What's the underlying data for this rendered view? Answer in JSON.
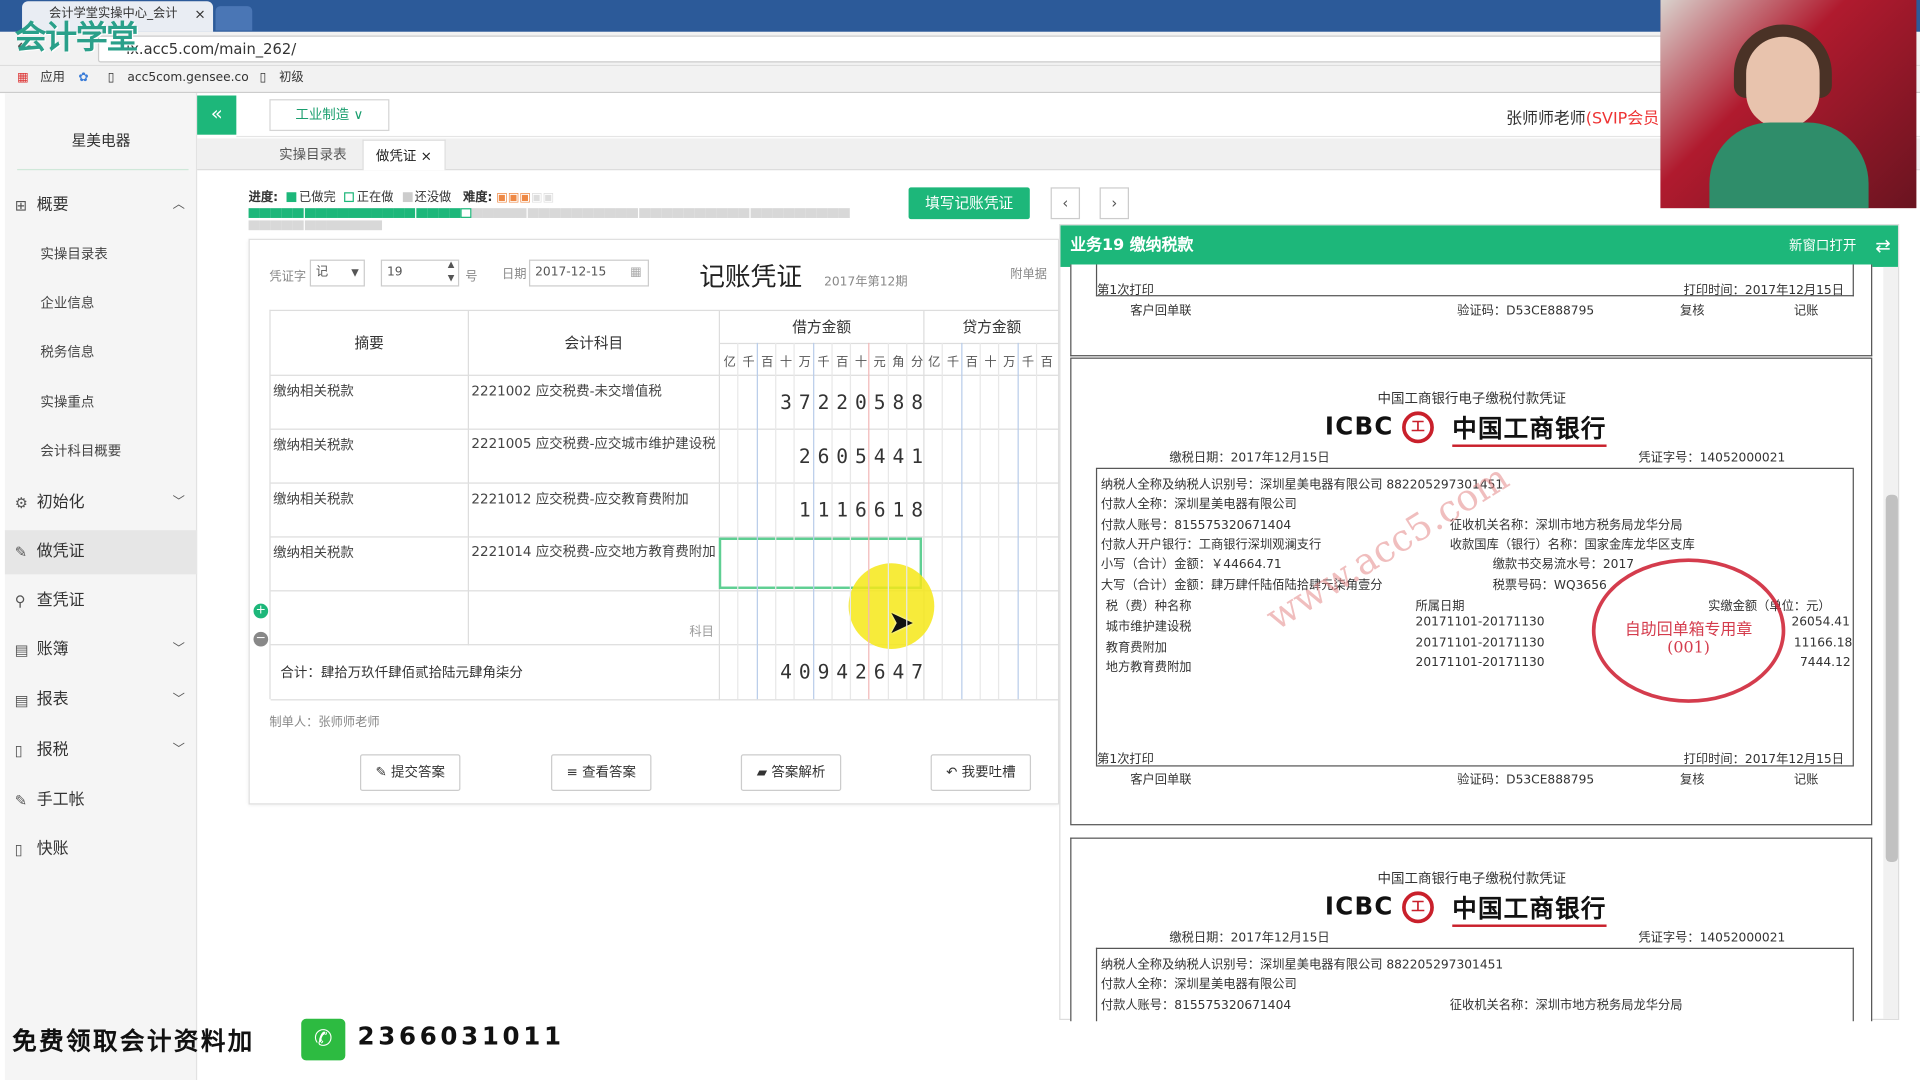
{
  "browser": {
    "tab_title": "会计学堂实操中心_会计",
    "tab_close": "×",
    "url": "lx.acc5.com/main_262/",
    "bookmarks": [
      "应用",
      "acc5com.gensee.co",
      "初级"
    ],
    "overlay_logo": "会计学堂"
  },
  "sidebar": {
    "company": "星美电器",
    "groups": [
      {
        "label": "概要",
        "icon": "grid-icon",
        "expanded": true
      },
      {
        "label": "初始化",
        "icon": "gear-icon",
        "expanded": false
      },
      {
        "label": "做凭证",
        "icon": "pen-icon",
        "active": true
      },
      {
        "label": "查凭证",
        "icon": "search-icon"
      },
      {
        "label": "账簿",
        "icon": "book-icon",
        "expanded": false
      },
      {
        "label": "报表",
        "icon": "list-icon",
        "expanded": false
      },
      {
        "label": "报税",
        "icon": "doc-icon",
        "expanded": false
      },
      {
        "label": "手工帐",
        "icon": "pen-icon"
      },
      {
        "label": "快账",
        "icon": "doc-icon"
      }
    ],
    "sub_items": [
      "实操目录表",
      "企业信息",
      "税务信息",
      "实操重点",
      "会计科目概要"
    ]
  },
  "header": {
    "collapse": "«",
    "industry": "工业制造 ∨",
    "user": "张师师老师",
    "user_level": "(SVIP会员"
  },
  "page_tabs": [
    "实操目录表",
    "做凭证"
  ],
  "page_tab_close": "×",
  "progress": {
    "label": "进度:",
    "done": "已做完",
    "doing": "正在做",
    "todo": "还没做",
    "difficulty_label": "难度:",
    "done_count": 19,
    "total_count": 66,
    "colors": {
      "done": "#1db77a",
      "current": "#ffffff",
      "todo": "#d8d8d8"
    }
  },
  "actions": {
    "fill_voucher": "填写记账凭证",
    "prev": "‹",
    "next": "›"
  },
  "voucher": {
    "word_label": "凭证字",
    "word_value": "记",
    "number": "19",
    "number_suffix": "号",
    "date_label": "日期",
    "date_value": "2017-12-15",
    "title": "记账凭证",
    "period": "2017年第12期",
    "attachments_label": "附单据",
    "col_summary": "摘要",
    "col_account": "会计科目",
    "col_debit": "借方金额",
    "col_credit": "贷方金额",
    "units": [
      "亿",
      "千",
      "百",
      "十",
      "万",
      "千",
      "百",
      "十",
      "元",
      "角",
      "分"
    ],
    "credit_units": [
      "亿",
      "千",
      "百",
      "十",
      "万",
      "千",
      "百"
    ],
    "rows": [
      {
        "summary": "缴纳相关税款",
        "account": "2221002 应交税费-未交增值税",
        "debit": "3722058 8"
      },
      {
        "summary": "缴纳相关税款",
        "account": "2221005 应交税费-应交城市维护建设税",
        "debit": "260544 1"
      },
      {
        "summary": "缴纳相关税款",
        "account": "2221012 应交税费-应交教育费附加",
        "debit": "111661 8"
      },
      {
        "summary": "缴纳相关税款",
        "account": "2221014 应交税费-应交地方教育费附加",
        "debit": ""
      }
    ],
    "debit_digits": [
      [
        "3",
        "7",
        "2",
        "2",
        "0",
        "5",
        "8",
        "8"
      ],
      [
        "2",
        "6",
        "0",
        "5",
        "4",
        "4",
        "1"
      ],
      [
        "1",
        "1",
        "1",
        "6",
        "6",
        "1",
        "8"
      ]
    ],
    "empty_row_hint": "科目",
    "total_label": "合计：肆拾万玖仟肆佰贰拾陆元肆角柒分",
    "total_digits": [
      "4",
      "0",
      "9",
      "4",
      "2",
      "6",
      "4",
      "7"
    ],
    "maker": "制单人：张师师老师"
  },
  "buttons": {
    "submit": "提交答案",
    "view": "查看答案",
    "analysis": "答案解析",
    "feedback": "我要吐槽"
  },
  "receipt_panel": {
    "title": "业务19 缴纳税款",
    "open_new": "新窗口打开",
    "top_strip": {
      "print_count": "第1次打印",
      "print_time": "打印时间：2017年12月15日",
      "copy": "客户回单联",
      "verify": "验证码：D53CE888795",
      "review": "复核",
      "post": "记账"
    },
    "doc": {
      "heading": "中国工商银行电子缴税付款凭证",
      "brand_en": "ICBC",
      "brand_cn": "中国工商银行",
      "logo_glyph": "工",
      "pay_date": "缴税日期：2017年12月15日",
      "voucher_no": "凭证字号：14052000021",
      "taxpayer": "纳税人全称及纳税人识别号：深圳星美电器有限公司 882205297301451",
      "payer_name": "付款人全称：深圳星美电器有限公司",
      "payer_acct": "付款人账号：815575320671404",
      "authority": "征收机关名称：深圳市地方税务局龙华分局",
      "payer_bank": "付款人开户银行：工商银行深圳观澜支行",
      "treasury": "收款国库（银行）名称：国家金库龙华区支库",
      "small_amount": "小写（合计）金额：￥44664.71",
      "serial": "缴款书交易流水号：2017",
      "big_amount": "大写（合计）金额：肆万肆仟陆佰陆拾肆元柒角壹分",
      "ticket_no": "税票号码：WQ3656",
      "tax_type": "税（费）种名称",
      "period_col": "所属日期",
      "amount_col": "实缴金额（单位：元）",
      "items": [
        {
          "name": "城市维护建设税",
          "period": "20171101-20171130",
          "amount": "26054.41"
        },
        {
          "name": "教育费附加",
          "period": "20171101-20171130",
          "amount": "11166.18"
        },
        {
          "name": "地方教育费附加",
          "period": "20171101-20171130",
          "amount": "7444.12"
        }
      ],
      "stamp_text": "自助回单箱专用章",
      "stamp_code": "(001)",
      "watermark": "www.acc5.com"
    }
  },
  "footer": {
    "promo": "免费领取会计资料加",
    "number": "2366031011"
  }
}
